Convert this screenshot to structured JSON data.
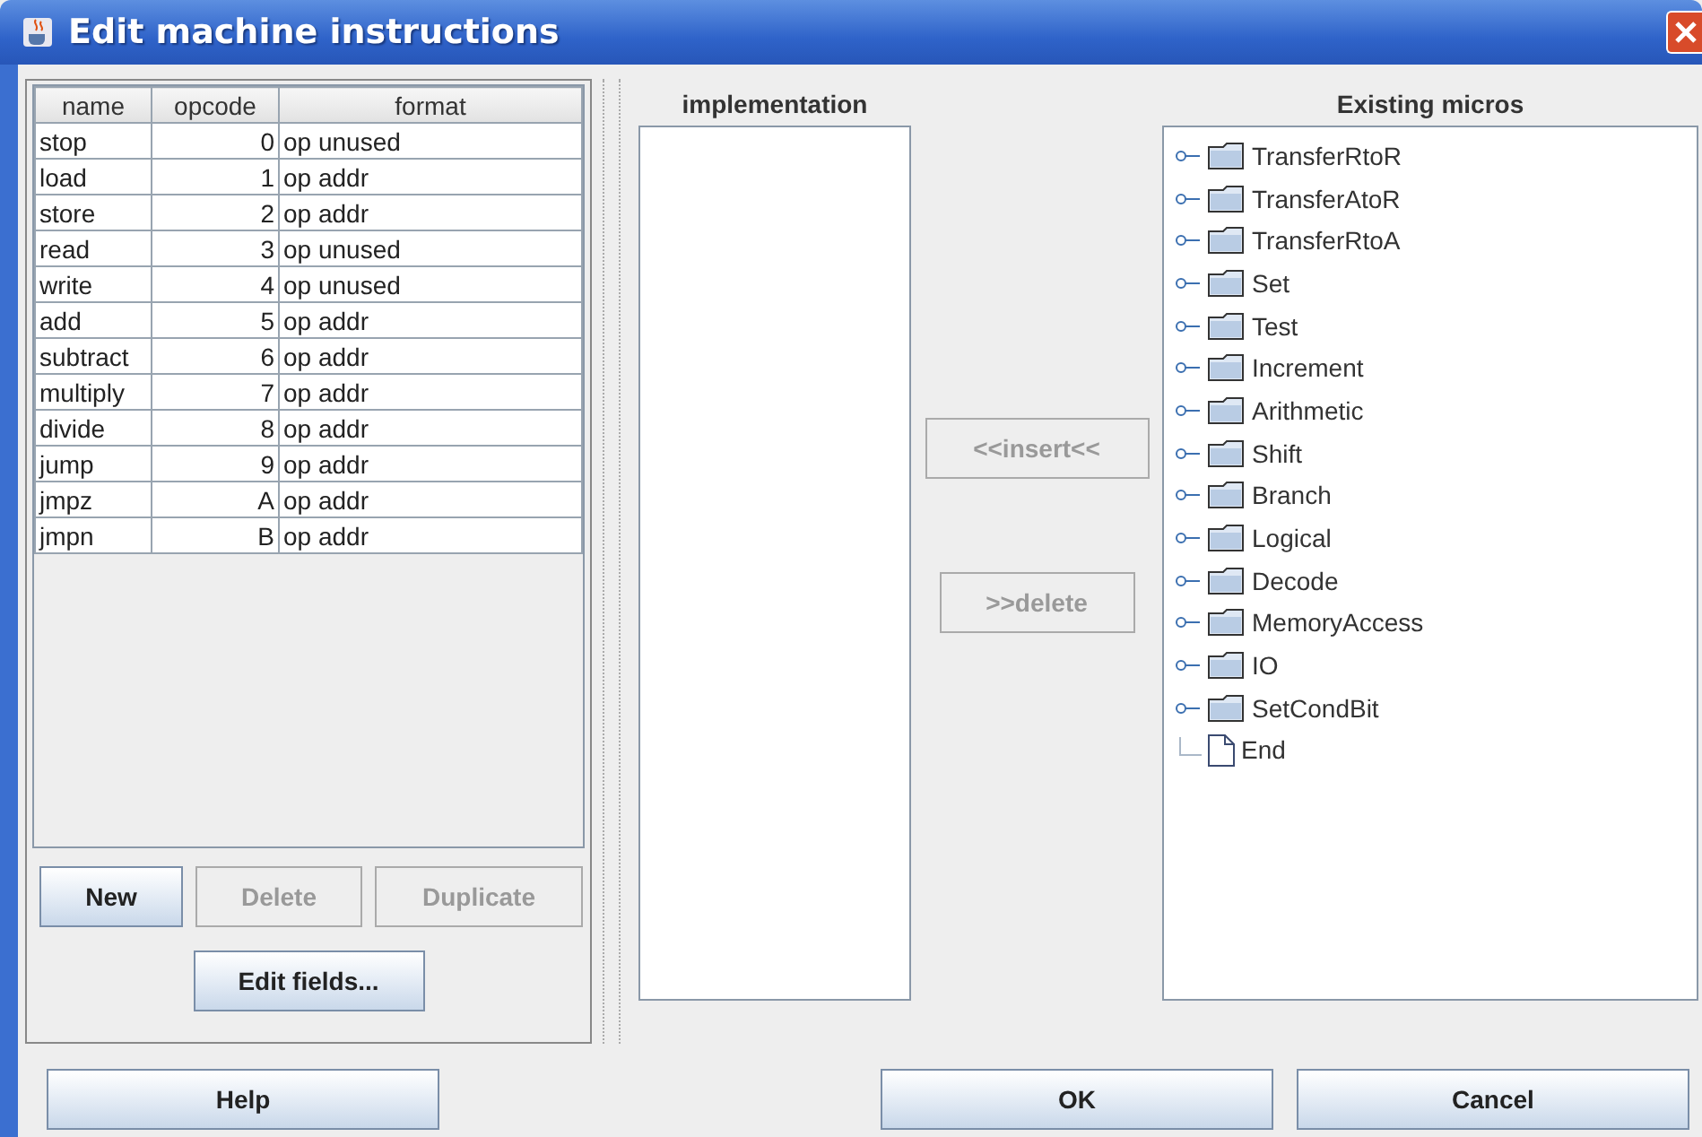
{
  "window": {
    "title": "Edit machine instructions"
  },
  "table": {
    "columns": [
      "name",
      "opcode",
      "format"
    ],
    "rows": [
      {
        "name": "stop",
        "opcode": "0",
        "format": "op unused",
        "selected": false
      },
      {
        "name": "load",
        "opcode": "1",
        "format": "op addr",
        "selected": false
      },
      {
        "name": "store",
        "opcode": "2",
        "format": "op addr",
        "selected": false
      },
      {
        "name": "read",
        "opcode": "3",
        "format": "op unused",
        "selected": false
      },
      {
        "name": "write",
        "opcode": "4",
        "format": "op unused",
        "selected": false
      },
      {
        "name": "add",
        "opcode": "5",
        "format": "op addr",
        "selected": false
      },
      {
        "name": "subtract",
        "opcode": "6",
        "format": "op addr",
        "selected": false
      },
      {
        "name": "multiply",
        "opcode": "7",
        "format": "op addr",
        "selected": false
      },
      {
        "name": "divide",
        "opcode": "8",
        "format": "op addr",
        "selected": false
      },
      {
        "name": "jump",
        "opcode": "9",
        "format": "op addr",
        "selected": false
      },
      {
        "name": "jmpz",
        "opcode": "A",
        "format": "op addr",
        "selected": false
      },
      {
        "name": "jmpn",
        "opcode": "B",
        "format": "op addr",
        "selected": false
      }
    ]
  },
  "table_buttons": [
    {
      "label": "New",
      "disabled": false
    },
    {
      "label": "Delete",
      "disabled": true
    },
    {
      "label": "Duplicate",
      "disabled": true
    }
  ],
  "edit_fields_button": {
    "label": "Edit fields...",
    "disabled": false
  },
  "implementation": {
    "title": "implementation"
  },
  "insert_button": {
    "label": "<<insert<<",
    "disabled": true
  },
  "delete_button": {
    "label": ">>delete",
    "disabled": true
  },
  "existing_micros": {
    "title": "Existing micros",
    "items": [
      {
        "label": "TransferRtoR",
        "kind": "folder"
      },
      {
        "label": "TransferAtoR",
        "kind": "folder"
      },
      {
        "label": "TransferRtoA",
        "kind": "folder"
      },
      {
        "label": "Set",
        "kind": "folder"
      },
      {
        "label": "Test",
        "kind": "folder"
      },
      {
        "label": "Increment",
        "kind": "folder"
      },
      {
        "label": "Arithmetic",
        "kind": "folder"
      },
      {
        "label": "Shift",
        "kind": "folder"
      },
      {
        "label": "Branch",
        "kind": "folder"
      },
      {
        "label": "Logical",
        "kind": "folder"
      },
      {
        "label": "Decode",
        "kind": "folder"
      },
      {
        "label": "MemoryAccess",
        "kind": "folder"
      },
      {
        "label": "IO",
        "kind": "folder"
      },
      {
        "label": "SetCondBit",
        "kind": "folder"
      },
      {
        "label": "End",
        "kind": "leaf"
      }
    ]
  },
  "footer_buttons": [
    {
      "label": "Help",
      "disabled": false
    },
    {
      "label": "OK",
      "disabled": false
    },
    {
      "label": "Cancel",
      "disabled": false
    }
  ]
}
